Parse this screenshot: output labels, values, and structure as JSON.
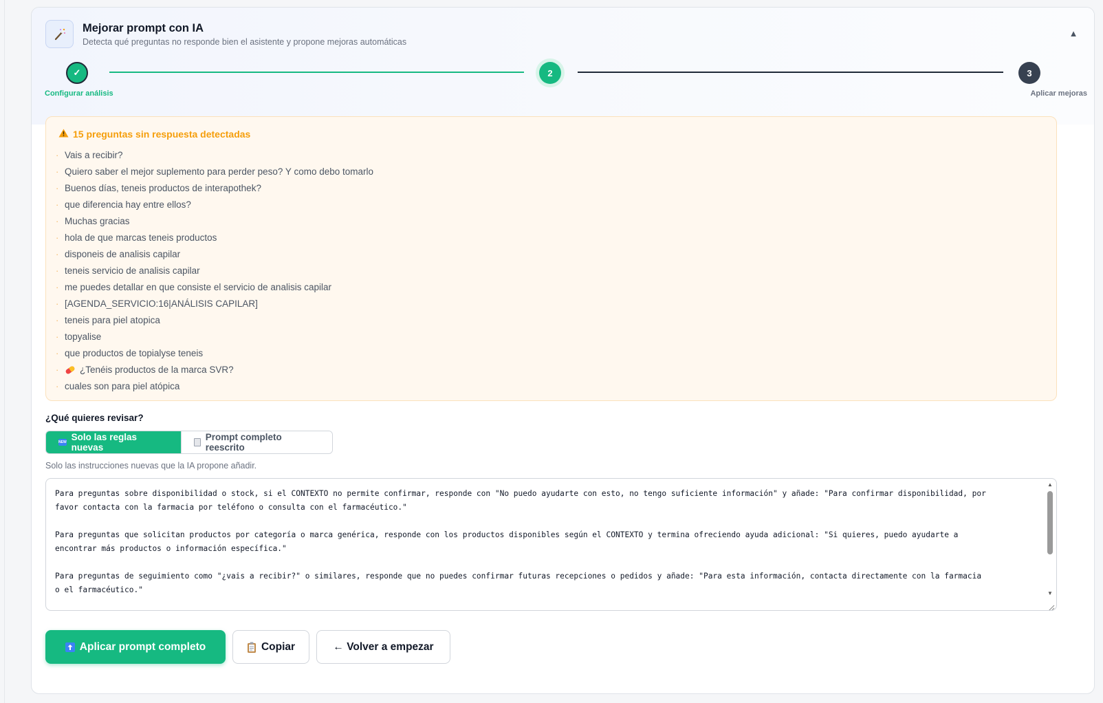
{
  "header": {
    "title": "Mejorar prompt con IA",
    "subtitle": "Detecta qué preguntas no responde bien el asistente y propone mejoras automáticas",
    "collapse_symbol": "▲",
    "icon": "magic-wand-icon"
  },
  "stepper": {
    "steps": [
      {
        "number": "1",
        "symbol": "✓",
        "label": "Configurar análisis",
        "state": "done"
      },
      {
        "number": "2",
        "symbol": "2",
        "label": "",
        "state": "active"
      },
      {
        "number": "3",
        "symbol": "3",
        "label": "Aplicar mejoras",
        "state": "pending"
      }
    ]
  },
  "warning": {
    "title": "15 preguntas sin respuesta detectadas",
    "questions": [
      "Vais a recibir?",
      "Quiero saber el mejor suplemento para perder peso? Y como debo tomarlo",
      "Buenos días, teneis productos de interapothek?",
      "que diferencia hay entre ellos?",
      "Muchas gracias",
      "hola de que marcas teneis productos",
      "disponeis de analisis capilar",
      "teneis servicio de analisis capilar",
      "me puedes detallar en que consiste el servicio de analisis capilar",
      "[AGENDA_SERVICIO:16|ANÁLISIS CAPILAR]",
      "teneis para piel atopica",
      "topyalise",
      "que productos de topialyse teneis",
      "¿Tenéis productos de la marca SVR?",
      "cuales son para piel atópica"
    ]
  },
  "review": {
    "label": "¿Qué quieres revisar?",
    "options": [
      {
        "label": "Solo las reglas nuevas",
        "icon": "new-badge-icon",
        "selected": true
      },
      {
        "label": "Prompt completo reescrito",
        "icon": "document-icon",
        "selected": false
      }
    ],
    "help_text": "Solo las instrucciones nuevas que la IA propone añadir.",
    "editor_text": "Para preguntas sobre disponibilidad o stock, si el CONTEXTO no permite confirmar, responde con \"No puedo ayudarte con esto, no tengo suficiente información\" y añade: \"Para confirmar disponibilidad, por\nfavor contacta con la farmacia por teléfono o consulta con el farmacéutico.\"\n\nPara preguntas que solicitan productos por categoría o marca genérica, responde con los productos disponibles según el CONTEXTO y termina ofreciendo ayuda adicional: \"Si quieres, puedo ayudarte a\nencontrar más productos o información específica.\"\n\nPara preguntas de seguimiento como \"¿vais a recibir?\" o similares, responde que no puedes confirmar futuras recepciones o pedidos y añade: \"Para esta información, contacta directamente con la farmacia\no el farmacéutico.\""
  },
  "actions": {
    "apply": "Aplicar prompt completo",
    "copy": "Copiar",
    "restart": "← Volver a empezar"
  },
  "colors": {
    "accent": "#16b981",
    "warning": "#f59e0b",
    "pending": "#374151"
  }
}
